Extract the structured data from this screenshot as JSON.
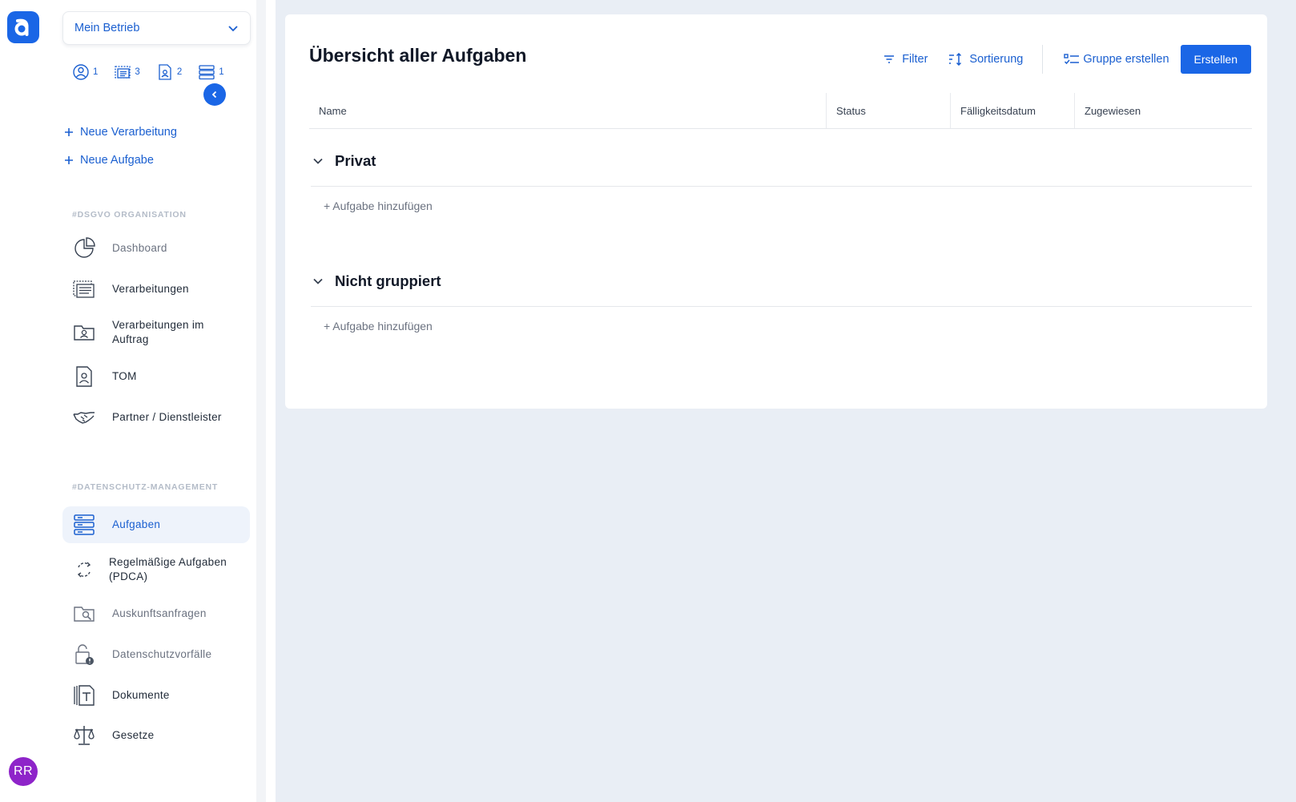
{
  "app": {
    "avatar_initials": "RR",
    "accent_color": "#1a66e6"
  },
  "sidebar": {
    "business_select": "Mein Betrieb",
    "counts": [
      {
        "icon": "user-circle-icon",
        "value": "1"
      },
      {
        "icon": "processing-list-icon",
        "value": "3"
      },
      {
        "icon": "contact-document-icon",
        "value": "2"
      },
      {
        "icon": "tasks-stack-icon",
        "value": "1"
      }
    ],
    "quick_actions": [
      {
        "label": "Neue Verarbeitung"
      },
      {
        "label": "Neue Aufgabe"
      }
    ],
    "sections": [
      {
        "title": "#DSGVO ORGANISATION",
        "items": [
          {
            "label": "Dashboard",
            "icon": "pie-chart-icon",
            "muted": true
          },
          {
            "label": "Verarbeitungen",
            "icon": "processing-list-icon"
          },
          {
            "label": "Verarbeitungen im Auftrag",
            "icon": "folder-person-icon"
          },
          {
            "label": "TOM",
            "icon": "contact-document-icon"
          },
          {
            "label": "Partner / Dienstleister",
            "icon": "handshake-icon"
          }
        ]
      },
      {
        "title": "#DATENSCHUTZ-MANAGEMENT",
        "items": [
          {
            "label": "Aufgaben",
            "icon": "tasks-stack-icon",
            "active": true
          },
          {
            "label": "Regelmäßige Aufgaben (PDCA)",
            "icon": "cycle-icon"
          },
          {
            "label": "Auskunftsanfragen",
            "icon": "folder-search-icon",
            "muted": true
          },
          {
            "label": "Datenschutzvorfälle",
            "icon": "lock-alert-icon",
            "muted": true
          },
          {
            "label": "Dokumente",
            "icon": "text-document-icon"
          },
          {
            "label": "Gesetze",
            "icon": "scale-icon"
          }
        ]
      }
    ]
  },
  "main": {
    "title": "Übersicht aller Aufgaben",
    "toolbar": {
      "filter": "Filter",
      "sort": "Sortierung",
      "create_group": "Gruppe erstellen",
      "create": "Erstellen"
    },
    "columns": [
      "Name",
      "Status",
      "Fälligkeitsdatum",
      "Zugewiesen"
    ],
    "groups": [
      {
        "name": "Privat",
        "add_label": "+ Aufgabe hinzufügen"
      },
      {
        "name": "Nicht gruppiert",
        "add_label": "+ Aufgabe hinzufügen"
      }
    ]
  }
}
